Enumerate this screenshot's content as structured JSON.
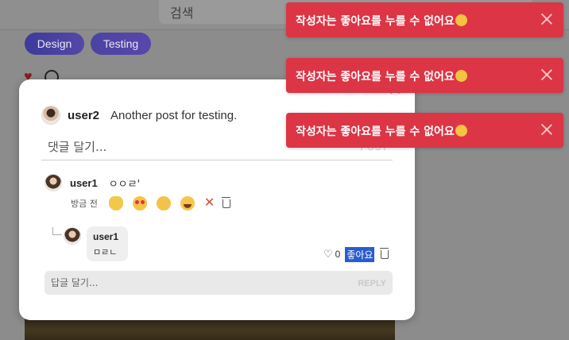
{
  "background": {
    "search_placeholder": "검색",
    "tags": [
      "Design",
      "Testing"
    ]
  },
  "modal": {
    "post": {
      "username": "user2",
      "text": "Another post for testing."
    },
    "comment_placeholder": "댓글 달기...",
    "post_button": "POST",
    "comment": {
      "username": "user1",
      "text": "ㅇㅇㄹ'",
      "time": "방금 전",
      "reactions": [
        "clapping-hands",
        "heart-eyes",
        "thinking-face",
        "grinning-sweat"
      ]
    },
    "reply": {
      "username": "user1",
      "text": "ㅁㄹㄴ",
      "like_count": "0",
      "like_label": "좋아요"
    },
    "reply_placeholder": "답글 달기...",
    "reply_button": "REPLY"
  },
  "toasts": [
    {
      "message": "작성자는 좋아요를 누를 수 없어요"
    },
    {
      "message": "작성자는 좋아요를 누를 수 없어요"
    },
    {
      "message": "작성자는 좋아요를 누를 수 없어요"
    }
  ],
  "colors": {
    "toast_bg": "#dc3545",
    "accent": "#2a5bd0"
  }
}
